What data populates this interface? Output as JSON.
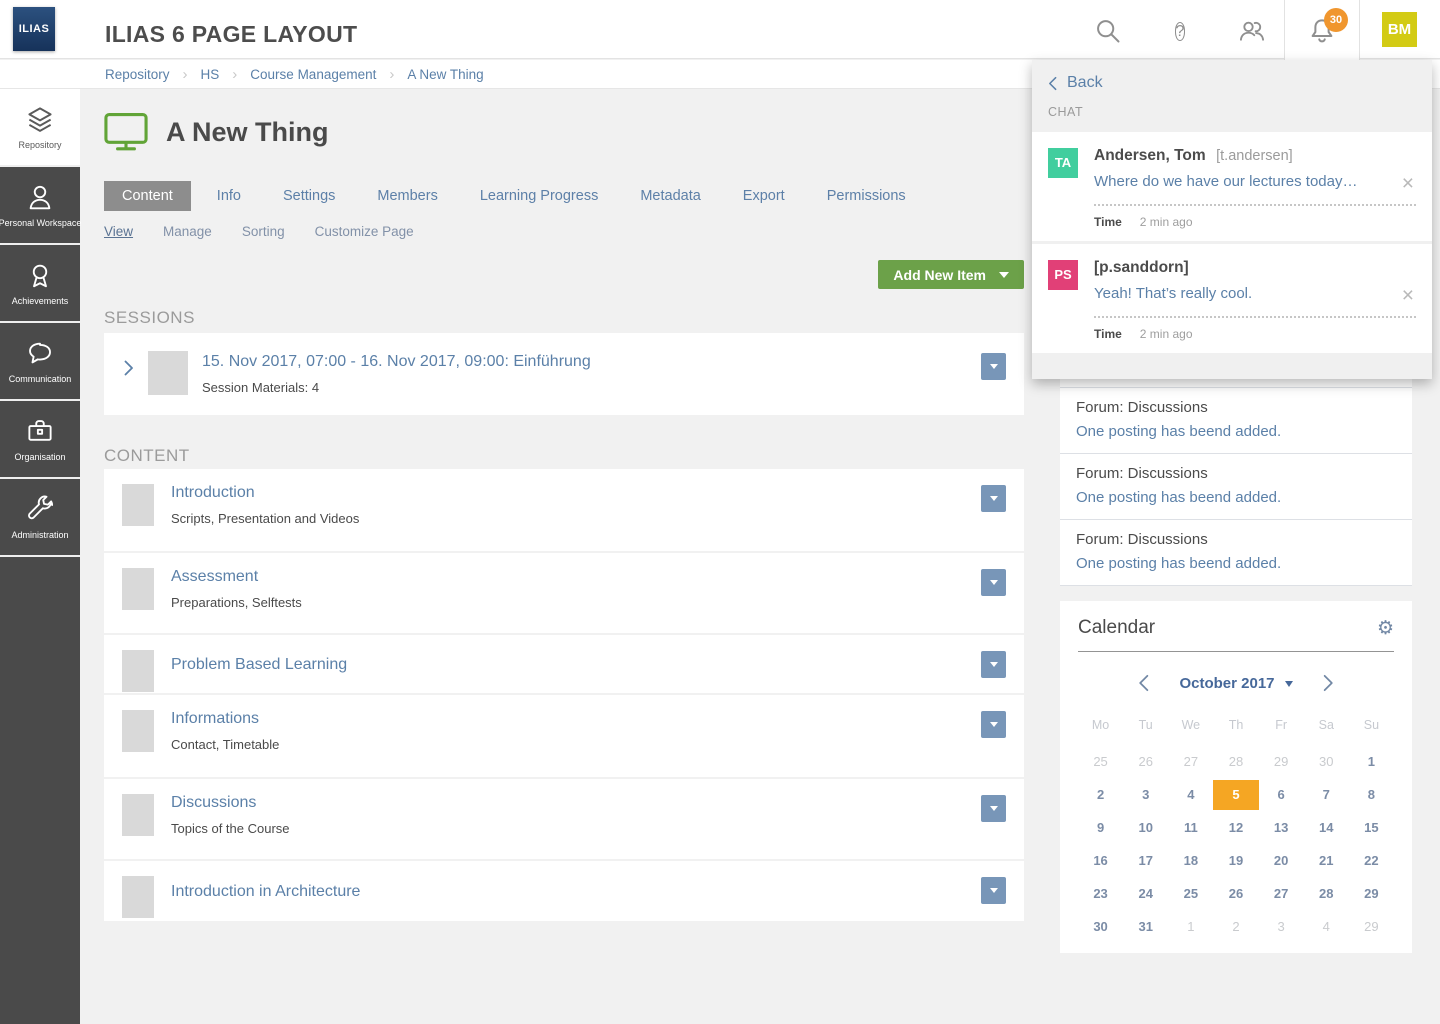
{
  "header": {
    "logo_text": "ILIAS",
    "title": "ILIAS 6 PAGE LAYOUT",
    "notification_count": "30",
    "avatar_initials": "BM"
  },
  "breadcrumb": {
    "items": [
      "Repository",
      "HS",
      "Course Management",
      "A New Thing"
    ]
  },
  "sidebar": {
    "items": [
      {
        "label": "Repository",
        "icon": "layers-icon",
        "active": true
      },
      {
        "label": "Personal Workspace",
        "icon": "person-icon",
        "active": false
      },
      {
        "label": "Achievements",
        "icon": "medal-icon",
        "active": false
      },
      {
        "label": "Communication",
        "icon": "speech-bubble-icon",
        "active": false
      },
      {
        "label": "Organisation",
        "icon": "briefcase-icon",
        "active": false
      },
      {
        "label": "Administration",
        "icon": "wrench-icon",
        "active": false
      }
    ]
  },
  "page": {
    "title": "A New Thing",
    "tabs": [
      {
        "label": "Content",
        "active": true
      },
      {
        "label": "Info",
        "active": false
      },
      {
        "label": "Settings",
        "active": false
      },
      {
        "label": "Members",
        "active": false
      },
      {
        "label": "Learning Progress",
        "active": false
      },
      {
        "label": "Metadata",
        "active": false
      },
      {
        "label": "Export",
        "active": false
      },
      {
        "label": "Permissions",
        "active": false
      }
    ],
    "subtabs": [
      {
        "label": "View",
        "active": true
      },
      {
        "label": "Manage",
        "active": false
      },
      {
        "label": "Sorting",
        "active": false
      },
      {
        "label": "Customize Page",
        "active": false
      }
    ],
    "add_button_label": "Add New Item"
  },
  "sessions": {
    "heading": "SESSIONS",
    "items": [
      {
        "title": "15. Nov 2017, 07:00 - 16. Nov 2017, 09:00: Einführung",
        "subtitle": "Session Materials: 4"
      }
    ]
  },
  "content": {
    "heading": "CONTENT",
    "items": [
      {
        "title": "Introduction",
        "subtitle": "Scripts, Presentation and Videos"
      },
      {
        "title": "Assessment",
        "subtitle": "Preparations, Selftests"
      },
      {
        "title": "Problem Based Learning",
        "subtitle": ""
      },
      {
        "title": "Informations",
        "subtitle": "Contact, Timetable"
      },
      {
        "title": "Discussions",
        "subtitle": "Topics of the Course"
      },
      {
        "title": "Introduction in Architecture",
        "subtitle": ""
      }
    ]
  },
  "chat_panel": {
    "back_label": "Back",
    "heading": "CHAT",
    "close_glyph": "×",
    "messages": [
      {
        "initials": "TA",
        "color": "#41ce9e",
        "name": "Andersen, Tom",
        "handle": "[t.andersen]",
        "message": "Where do we have our lectures today…",
        "time_label": "Time",
        "time_value": "2 min ago"
      },
      {
        "initials": "PS",
        "color": "#e14077",
        "name": "[p.sanddorn]",
        "handle": "",
        "message": "Yeah! That’s really cool.",
        "time_label": "Time",
        "time_value": "2 min ago"
      }
    ]
  },
  "forum_feed": {
    "items": [
      {
        "title": "Forum: Discussions",
        "link": "One posting has beend added."
      },
      {
        "title": "Forum: Discussions",
        "link": "One posting has beend added."
      },
      {
        "title": "Forum: Discussions",
        "link": "One posting has beend added."
      }
    ]
  },
  "calendar": {
    "title": "Calendar",
    "month_label": "October 2017",
    "gear_glyph": "⚙",
    "day_headers": [
      "Mo",
      "Tu",
      "We",
      "Th",
      "Fr",
      "Sa",
      "Su"
    ],
    "selected_day": "5",
    "weeks": [
      [
        {
          "n": "25",
          "muted": true
        },
        {
          "n": "26",
          "muted": true
        },
        {
          "n": "27",
          "muted": true
        },
        {
          "n": "28",
          "muted": true
        },
        {
          "n": "29",
          "muted": true
        },
        {
          "n": "30",
          "muted": true
        },
        {
          "n": "1"
        }
      ],
      [
        {
          "n": "2"
        },
        {
          "n": "3"
        },
        {
          "n": "4"
        },
        {
          "n": "5",
          "selected": true
        },
        {
          "n": "6"
        },
        {
          "n": "7"
        },
        {
          "n": "8"
        }
      ],
      [
        {
          "n": "9"
        },
        {
          "n": "10"
        },
        {
          "n": "11"
        },
        {
          "n": "12"
        },
        {
          "n": "13"
        },
        {
          "n": "14"
        },
        {
          "n": "15"
        }
      ],
      [
        {
          "n": "16"
        },
        {
          "n": "17"
        },
        {
          "n": "18"
        },
        {
          "n": "19"
        },
        {
          "n": "20"
        },
        {
          "n": "21"
        },
        {
          "n": "22"
        }
      ],
      [
        {
          "n": "23"
        },
        {
          "n": "24"
        },
        {
          "n": "25"
        },
        {
          "n": "26"
        },
        {
          "n": "27"
        },
        {
          "n": "28"
        },
        {
          "n": "29"
        }
      ],
      [
        {
          "n": "30"
        },
        {
          "n": "31"
        },
        {
          "n": "1",
          "muted": true
        },
        {
          "n": "2",
          "muted": true
        },
        {
          "n": "3",
          "muted": true
        },
        {
          "n": "4",
          "muted": true
        },
        {
          "n": "29",
          "muted": true
        }
      ]
    ]
  },
  "colors": {
    "accent_link": "#5b80a8",
    "button_green": "#6ca149",
    "selected_day_orange": "#f5a623",
    "badge_orange": "#f0962e",
    "sidebar_bg": "#4a4a4a",
    "active_tab_gray": "#8d8d8d",
    "logo_navy": "#1d3b63",
    "monitor_green": "#61a437"
  }
}
